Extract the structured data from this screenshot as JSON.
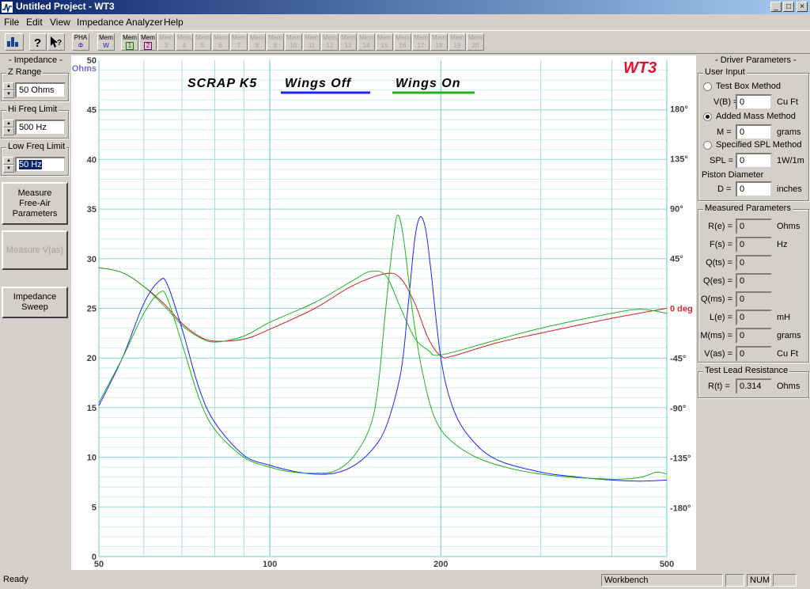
{
  "window": {
    "title": "Untitled Project - WT3",
    "min": "_",
    "max": "□",
    "close": "×"
  },
  "menu": [
    "File",
    "Edit",
    "View",
    "Impedance Analyzer",
    "Help"
  ],
  "toolbar": {
    "pha_label": "PHA",
    "pha_sub": "Φ",
    "mem_w_label": "Mem",
    "mem_w_sub": "W",
    "mem_label": "Mem",
    "mem_numbers": [
      "1",
      "2",
      "3",
      "4",
      "5",
      "6",
      "7",
      "8",
      "9",
      "10",
      "11",
      "12",
      "13",
      "14",
      "15",
      "16",
      "17",
      "18",
      "19",
      "20"
    ]
  },
  "left": {
    "impedance_header": "- Impedance -",
    "z_range_label": "Z Range",
    "z_range_value": "50 Ohms",
    "hi_freq_label": "Hi Freq Limit",
    "hi_freq_value": "500 Hz",
    "low_freq_label": "Low Freq Limit",
    "low_freq_value": "50 Hz",
    "measure_free_air": "Measure\nFree-Air\nParameters",
    "measure_vas": "Measure V(as)",
    "impedance_sweep": "Impedance\nSweep"
  },
  "right": {
    "header": "- Driver Parameters -",
    "user_input": "User Input",
    "test_box": "Test Box Method",
    "vb_label": "V(B) =",
    "vb_value": "0",
    "vb_unit": "Cu Ft",
    "added_mass": "Added Mass Method",
    "m_label": "M =",
    "m_value": "0",
    "m_unit": "grams",
    "specified_spl": "Specified SPL Method",
    "spl_label": "SPL =",
    "spl_value": "0",
    "spl_unit": "1W/1m",
    "piston": "Piston Diameter",
    "d_label": "D =",
    "d_value": "0",
    "d_unit": "inches",
    "measured": "Measured Parameters",
    "params": [
      {
        "label": "R(e) =",
        "value": "0",
        "unit": "Ohms"
      },
      {
        "label": "F(s) =",
        "value": "0",
        "unit": "Hz"
      },
      {
        "label": "Q(ts) =",
        "value": "0",
        "unit": ""
      },
      {
        "label": "Q(es) =",
        "value": "0",
        "unit": ""
      },
      {
        "label": "Q(ms) =",
        "value": "0",
        "unit": ""
      },
      {
        "label": "L(e) =",
        "value": "0",
        "unit": "mH"
      },
      {
        "label": "M(ms) =",
        "value": "0",
        "unit": "grams"
      },
      {
        "label": "V(as) =",
        "value": "0",
        "unit": "Cu Ft"
      }
    ],
    "test_lead": "Test Lead Resistance",
    "rt_label": "R(t) =",
    "rt_value": "0.314",
    "rt_unit": "Ohms"
  },
  "status": {
    "text": "Ready",
    "panel": "Workbench",
    "num": "NUM"
  },
  "colors": {
    "blue": "#2020ff",
    "green": "#20b020",
    "red": "#d02020",
    "grid": "#9ee0e0",
    "wt3": "#e01030"
  },
  "chart_data": {
    "type": "line",
    "logo": "WT3",
    "annotations": [
      "SCRAP K5",
      "Wings Off",
      "Wings On"
    ],
    "y_unit": "Ohms",
    "y_ticks": [
      "0",
      "5",
      "10",
      "15",
      "20",
      "25",
      "30",
      "35",
      "40",
      "45",
      "50"
    ],
    "ylim": [
      0,
      50
    ],
    "x_ticks": [
      "50",
      "100",
      "200",
      "500"
    ],
    "x_scale": "log",
    "xlim": [
      50,
      500
    ],
    "phase_ticks": [
      "180°",
      "135°",
      "90°",
      "45°",
      "0 deg",
      "-45°",
      "-90°",
      "-135°",
      "-180°"
    ],
    "phase_lim": [
      -180,
      180
    ],
    "phase_zero_y": 25,
    "series": [
      {
        "name": "Wings Off",
        "kind": "impedance",
        "color": "#2020ff",
        "points": [
          [
            50,
            15.2
          ],
          [
            55,
            20
          ],
          [
            60,
            25.5
          ],
          [
            64,
            27.8
          ],
          [
            66,
            27.4
          ],
          [
            70,
            23
          ],
          [
            75,
            17
          ],
          [
            80,
            13.5
          ],
          [
            90,
            10.2
          ],
          [
            100,
            9.2
          ],
          [
            110,
            8.6
          ],
          [
            120,
            8.3
          ],
          [
            130,
            8.4
          ],
          [
            140,
            9.1
          ],
          [
            150,
            10.5
          ],
          [
            160,
            13
          ],
          [
            170,
            18.5
          ],
          [
            175,
            25
          ],
          [
            180,
            32
          ],
          [
            184,
            34.2
          ],
          [
            188,
            33
          ],
          [
            192,
            29
          ],
          [
            200,
            20
          ],
          [
            210,
            15
          ],
          [
            225,
            12
          ],
          [
            250,
            9.8
          ],
          [
            300,
            8.5
          ],
          [
            350,
            8
          ],
          [
            400,
            7.7
          ],
          [
            450,
            7.6
          ],
          [
            500,
            7.7
          ]
        ]
      },
      {
        "name": "Wings On",
        "kind": "impedance",
        "color": "#20b020",
        "points": [
          [
            50,
            15.5
          ],
          [
            55,
            20
          ],
          [
            60,
            24.5
          ],
          [
            64,
            26.6
          ],
          [
            66,
            26
          ],
          [
            70,
            21.5
          ],
          [
            75,
            16
          ],
          [
            80,
            12.8
          ],
          [
            90,
            10
          ],
          [
            100,
            9
          ],
          [
            110,
            8.5
          ],
          [
            120,
            8.4
          ],
          [
            130,
            8.6
          ],
          [
            140,
            10
          ],
          [
            150,
            13
          ],
          [
            155,
            17
          ],
          [
            160,
            25
          ],
          [
            165,
            32
          ],
          [
            168,
            34.4
          ],
          [
            172,
            32
          ],
          [
            178,
            25
          ],
          [
            185,
            19
          ],
          [
            195,
            14
          ],
          [
            210,
            11.5
          ],
          [
            240,
            9.6
          ],
          [
            300,
            8.3
          ],
          [
            400,
            7.8
          ],
          [
            450,
            8
          ],
          [
            480,
            8.5
          ],
          [
            500,
            8.3
          ]
        ]
      },
      {
        "name": "Phase Off",
        "kind": "phase",
        "color": "#d02020",
        "points": [
          [
            50,
            29.1
          ],
          [
            55,
            28.6
          ],
          [
            60,
            27.2
          ],
          [
            65,
            25.5
          ],
          [
            70,
            23.5
          ],
          [
            75,
            22.2
          ],
          [
            80,
            21.7
          ],
          [
            90,
            21.9
          ],
          [
            100,
            22.9
          ],
          [
            120,
            25
          ],
          [
            140,
            27.3
          ],
          [
            160,
            28.5
          ],
          [
            170,
            28
          ],
          [
            180,
            25.5
          ],
          [
            190,
            22
          ],
          [
            200,
            20.2
          ],
          [
            210,
            20.2
          ],
          [
            250,
            21.5
          ],
          [
            300,
            22.5
          ],
          [
            400,
            24
          ],
          [
            500,
            25
          ]
        ]
      },
      {
        "name": "Phase On",
        "kind": "phase",
        "color": "#20b020",
        "points": [
          [
            50,
            29.1
          ],
          [
            55,
            28.6
          ],
          [
            60,
            27.2
          ],
          [
            65,
            25.3
          ],
          [
            70,
            23.3
          ],
          [
            75,
            22.1
          ],
          [
            80,
            21.6
          ],
          [
            90,
            22.2
          ],
          [
            100,
            23.6
          ],
          [
            120,
            25.6
          ],
          [
            140,
            27.8
          ],
          [
            150,
            28.7
          ],
          [
            160,
            28.3
          ],
          [
            170,
            25
          ],
          [
            180,
            22
          ],
          [
            190,
            20.8
          ],
          [
            200,
            20.3
          ],
          [
            250,
            21.8
          ],
          [
            300,
            23
          ],
          [
            400,
            24.5
          ],
          [
            450,
            24.9
          ],
          [
            500,
            24.5
          ]
        ]
      }
    ]
  }
}
